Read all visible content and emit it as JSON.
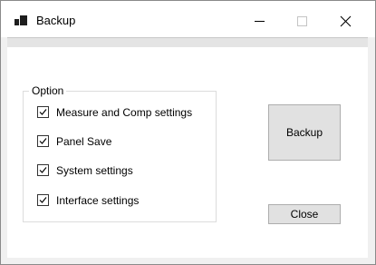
{
  "window": {
    "title": "Backup"
  },
  "group": {
    "label": "Option"
  },
  "options": [
    {
      "label": "Measure and Comp settings",
      "checked": true
    },
    {
      "label": "Panel Save",
      "checked": true
    },
    {
      "label": "System settings",
      "checked": true
    },
    {
      "label": "Interface settings",
      "checked": true
    }
  ],
  "buttons": {
    "backup_label": "Backup",
    "close_label": "Close"
  },
  "icons": {
    "app": "app-icon",
    "minimize": "minimize-icon",
    "maximize": "maximize-icon",
    "close": "close-icon",
    "check": "checkmark-icon"
  }
}
